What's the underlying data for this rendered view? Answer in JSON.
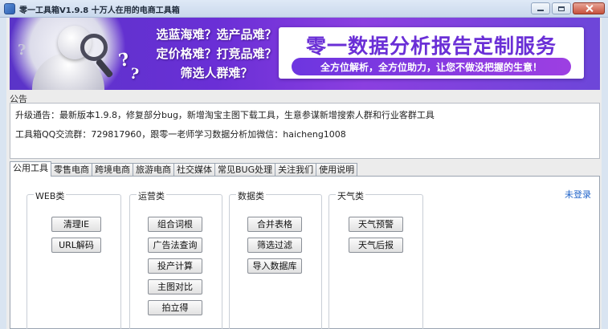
{
  "window": {
    "title": "零一工具箱V1.9.8 十万人在用的电商工具箱"
  },
  "banner": {
    "questions": [
      "选蓝海难？选产品难？",
      "定价格难？打竞品难？",
      "筛选人群难？"
    ],
    "headline": "零一数据分析报告定制服务",
    "subline": "全方位解析，全方位助力，让您不做没把握的生意！"
  },
  "notice": {
    "label": "公告",
    "lines": [
      "升级通告：最新版本1.9.8，修复部分bug，新增淘宝主图下载工具，生意参谋新增搜索人群和行业客群工具",
      "工具箱QQ交流群：729817960，跟零一老师学习数据分析加微信：haicheng1008"
    ]
  },
  "tabs": [
    "公用工具",
    "零售电商",
    "跨境电商",
    "旅游电商",
    "社交媒体",
    "常见BUG处理",
    "关注我们",
    "使用说明"
  ],
  "active_tab": "公用工具",
  "login_status": "未登录",
  "groups": [
    {
      "title": "WEB类",
      "buttons": [
        "清理IE",
        "URL解码"
      ]
    },
    {
      "title": "运营类",
      "buttons": [
        "组合词根",
        "广告法查询",
        "投产计算",
        "主图对比",
        "拍立得"
      ]
    },
    {
      "title": "数据类",
      "buttons": [
        "合并表格",
        "筛选过滤",
        "导入数据库"
      ]
    },
    {
      "title": "天气类",
      "buttons": [
        "天气预警",
        "天气后报"
      ]
    }
  ],
  "icons": {
    "app": "toolbox-icon",
    "minimize": "minimize-icon",
    "maximize": "maximize-icon",
    "close": "close-icon"
  },
  "colors": {
    "banner_purple": "#6a2fd6",
    "login_link": "#1f63c9"
  }
}
